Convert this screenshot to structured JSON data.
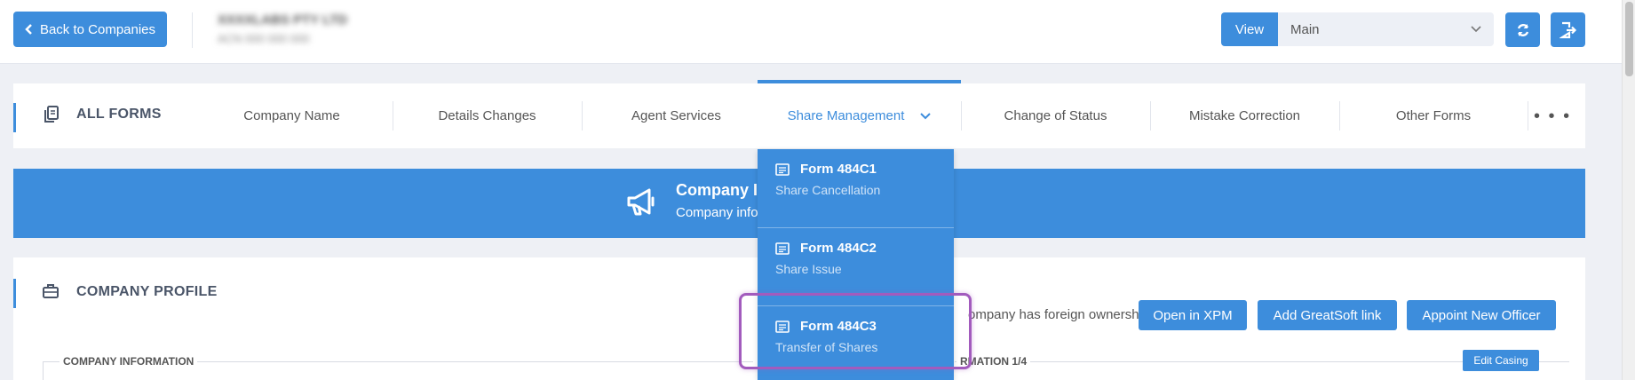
{
  "topbar": {
    "back_label": "Back to Companies",
    "company_name": "XXXXLABS PTY LTD",
    "company_id": "ACN 000 000 000",
    "view_label": "View",
    "view_selected": "Main"
  },
  "forms_nav": {
    "title": "ALL FORMS",
    "items": [
      {
        "label": "Company Name"
      },
      {
        "label": "Details Changes"
      },
      {
        "label": "Agent Services"
      },
      {
        "label": "Share Management"
      },
      {
        "label": "Change of Status"
      },
      {
        "label": "Mistake Correction"
      },
      {
        "label": "Other Forms"
      }
    ],
    "active_index": 3,
    "more": "• • •"
  },
  "banner": {
    "title": "Company I",
    "subtitle": "Company info"
  },
  "dropdown": {
    "items": [
      {
        "code": "Form 484C1",
        "name": "Share Cancellation"
      },
      {
        "code": "Form 484C2",
        "name": "Share Issue"
      },
      {
        "code": "Form 484C3",
        "name": "Transfer of Shares"
      }
    ]
  },
  "profile": {
    "title": "COMPANY PROFILE",
    "foreign_ownership": "ompany has foreign ownership",
    "buttons": [
      "Open in XPM",
      "Add GreatSoft link",
      "Appoint New Officer"
    ],
    "company_info_label": "COMPANY INFORMATION",
    "right_label": "RMATION 1/4",
    "edit_casing": "Edit Casing"
  },
  "colors": {
    "accent": "#3d8ddc",
    "highlight": "#a25bbd"
  }
}
